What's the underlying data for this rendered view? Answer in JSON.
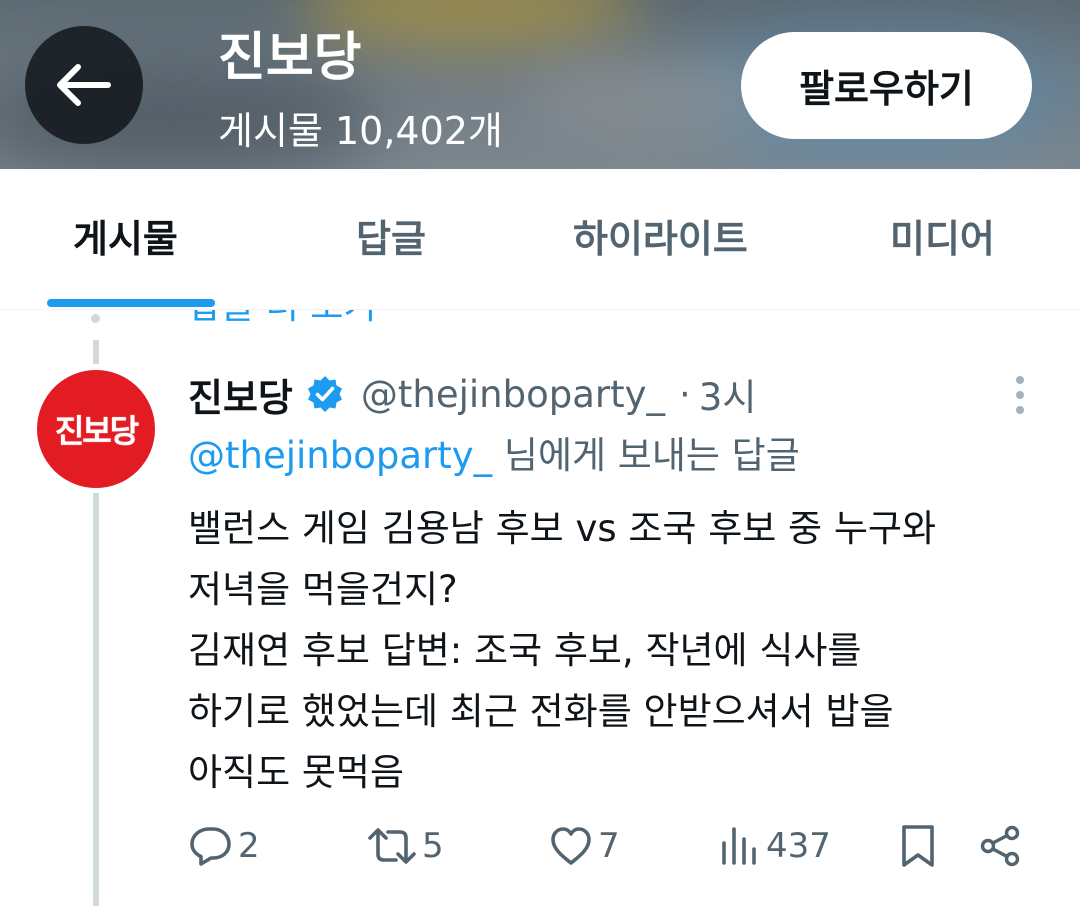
{
  "header": {
    "title": "진보당",
    "post_count": "게시물 10,402개",
    "follow_label": "팔로우하기"
  },
  "tabs": [
    {
      "label": "게시물",
      "active": true
    },
    {
      "label": "답글",
      "active": false
    },
    {
      "label": "하이라이트",
      "active": false
    },
    {
      "label": "미디어",
      "active": false
    }
  ],
  "thread": {
    "prev_link": "답글 더 보기"
  },
  "tweet": {
    "avatar_text": "진보당",
    "name": "진보당",
    "handle": "@thejinboparty_",
    "separator": "·",
    "time": "3시",
    "reply_to_handle": "@thejinboparty_",
    "reply_to_suffix": " 님에게 보내는 답글",
    "text_lines": [
      "밸런스 게임 김용남 후보 vs 조국 후보 중 누구와",
      "저녁을 먹을건지?",
      "김재연 후보 답변: 조국 후보, 작년에 식사를",
      "하기로 했었는데 최근 전화를 안받으셔서 밥을",
      "아직도 못먹음"
    ],
    "stats": {
      "replies": "2",
      "retweets": "5",
      "likes": "7",
      "views": "437"
    }
  },
  "colors": {
    "accent": "#1d9bf0",
    "avatar_bg": "#e31b23",
    "muted": "#536471"
  }
}
